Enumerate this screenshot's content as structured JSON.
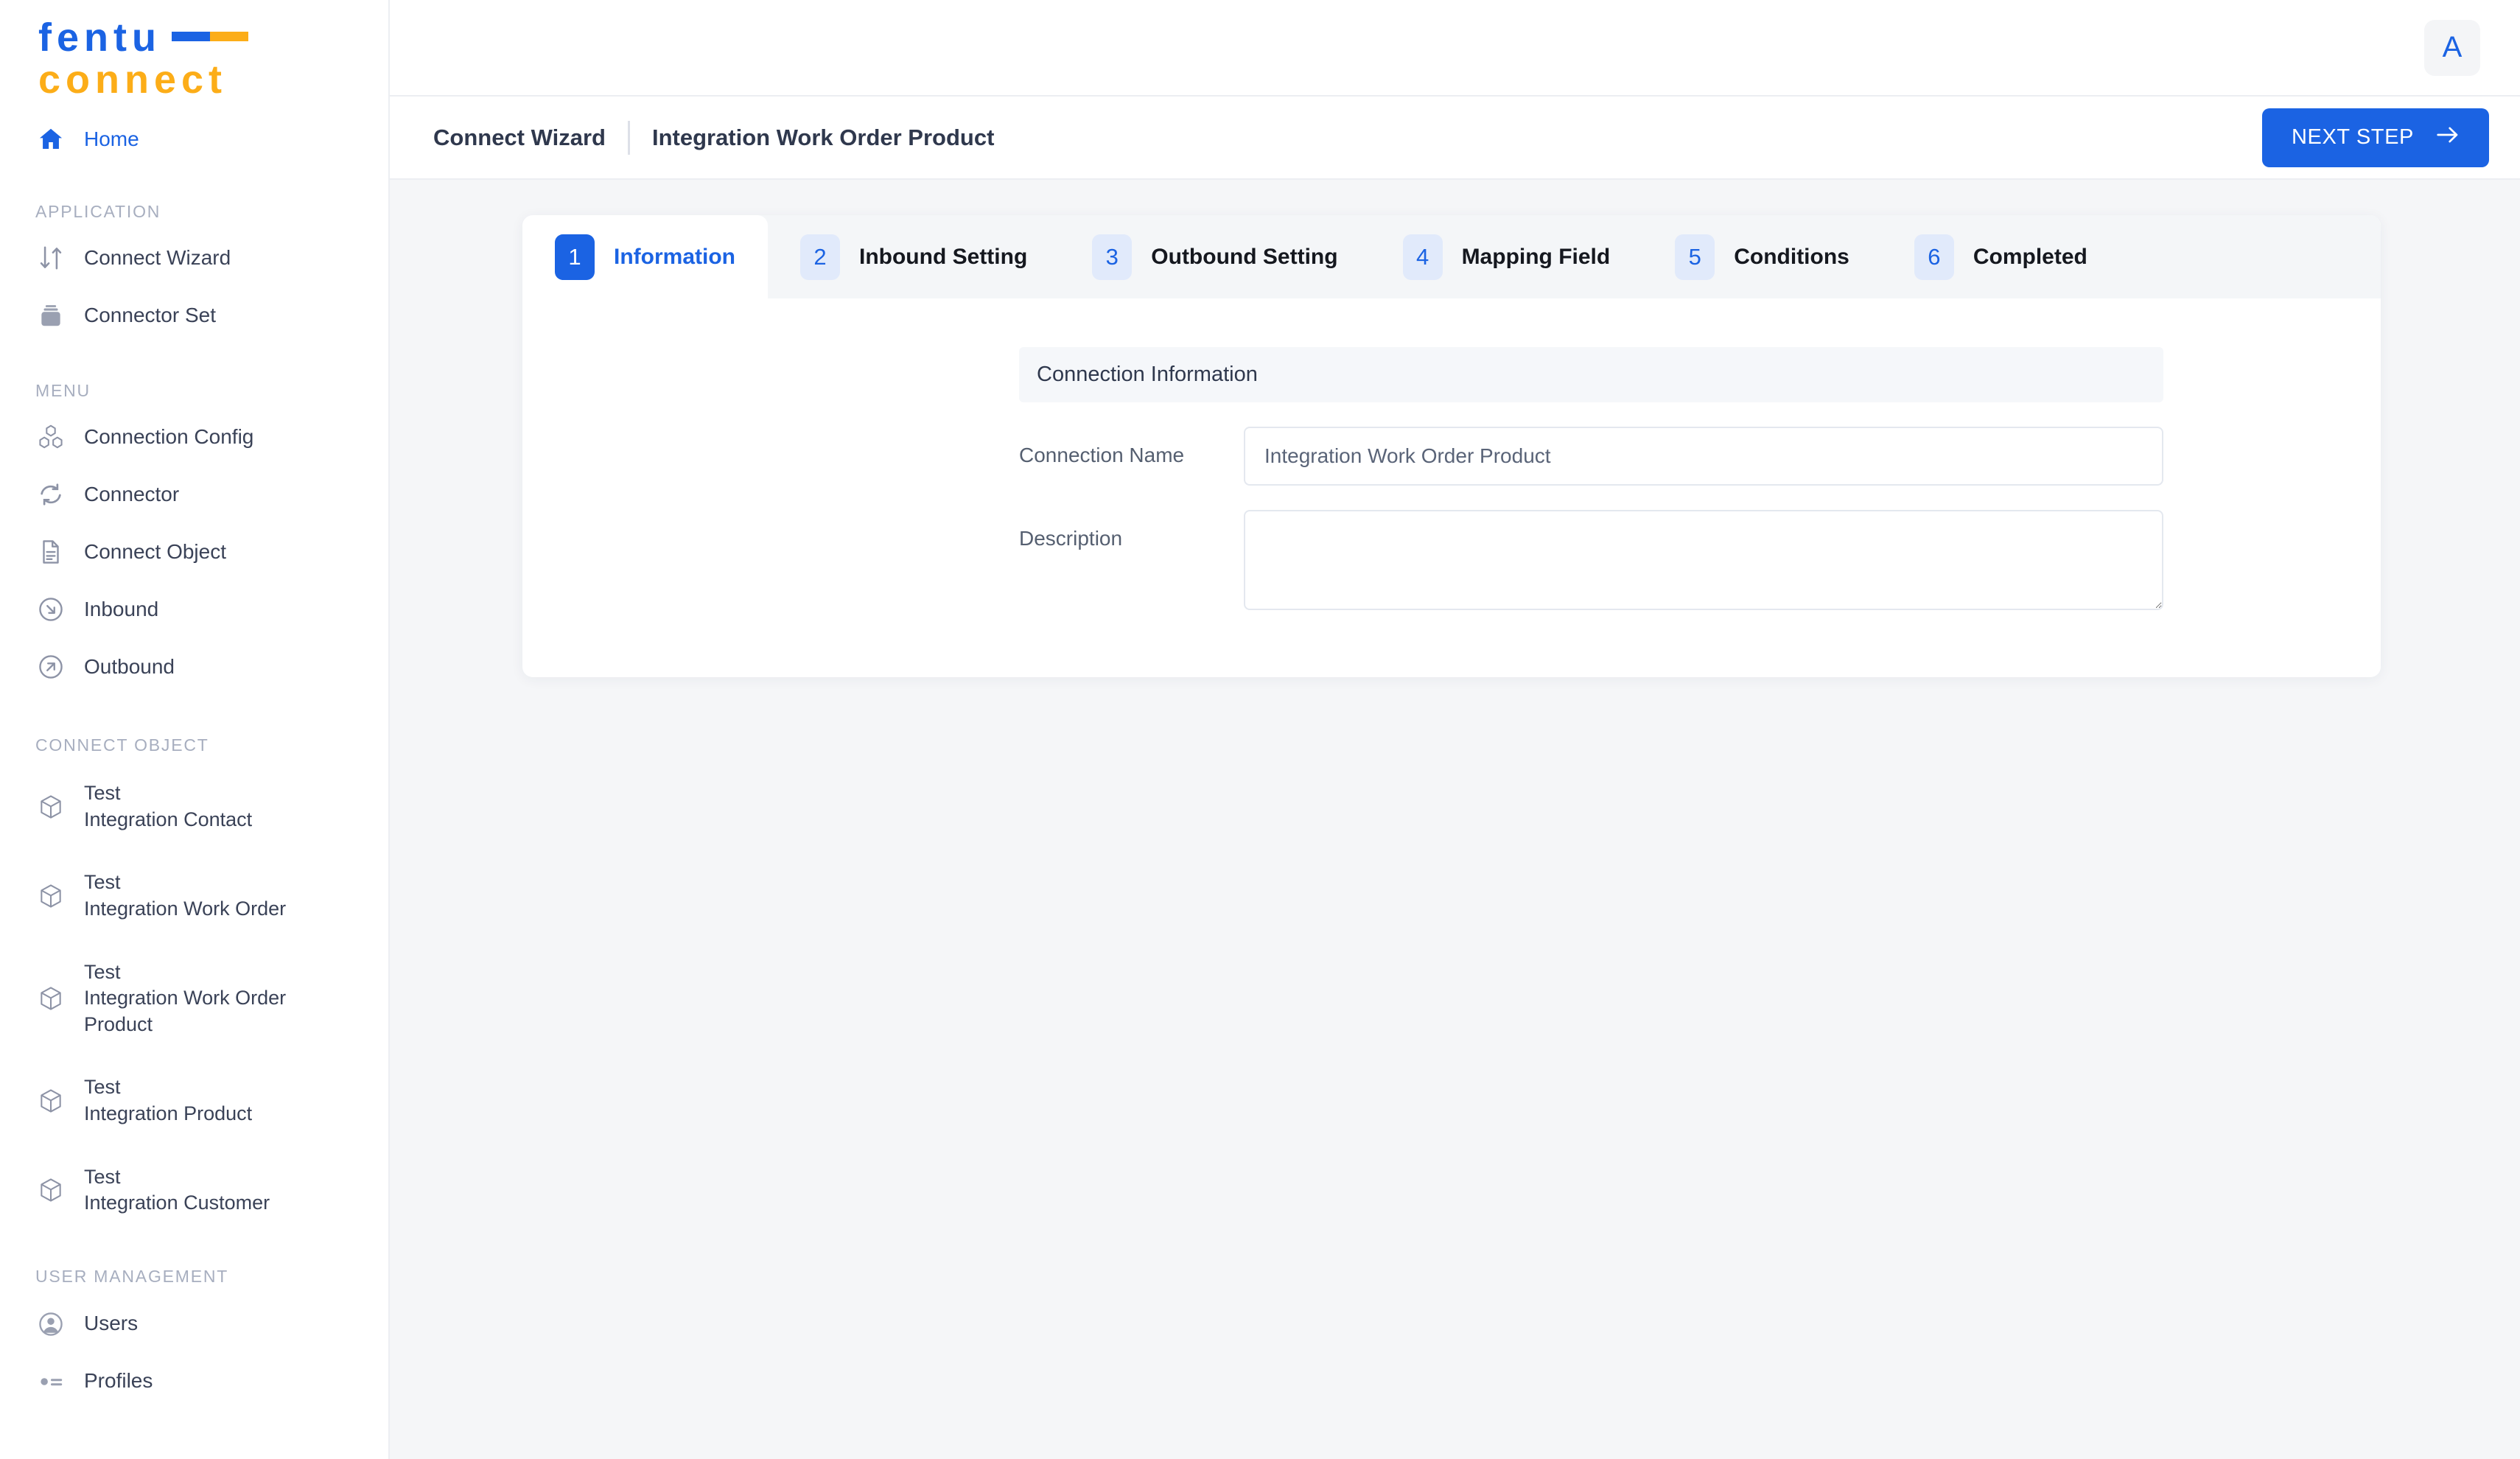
{
  "brand": {
    "word1": "fentu",
    "word2": "connect"
  },
  "sidebar": {
    "home": {
      "label": "Home"
    },
    "sections": [
      {
        "title": "APPLICATION",
        "items": [
          {
            "label": "Connect Wizard",
            "icon": "transfer-arrows-icon"
          },
          {
            "label": "Connector Set",
            "icon": "stack-icon"
          }
        ]
      },
      {
        "title": "MENU",
        "items": [
          {
            "label": "Connection Config",
            "icon": "blocks-icon"
          },
          {
            "label": "Connector",
            "icon": "sync-icon"
          },
          {
            "label": "Connect Object",
            "icon": "document-icon"
          },
          {
            "label": "Inbound",
            "icon": "arrow-down-right-circle-icon"
          },
          {
            "label": "Outbound",
            "icon": "arrow-up-right-circle-icon"
          }
        ]
      },
      {
        "title": "CONNECT OBJECT",
        "objects": [
          {
            "line1": "Test",
            "line2": "Integration Contact"
          },
          {
            "line1": "Test",
            "line2": "Integration Work Order"
          },
          {
            "line1": "Test",
            "line2": "Integration Work Order Product"
          },
          {
            "line1": "Test",
            "line2": "Integration Product"
          },
          {
            "line1": "Test",
            "line2": "Integration Customer"
          }
        ]
      },
      {
        "title": "USER MANAGEMENT",
        "items": [
          {
            "label": "Users",
            "icon": "user-circle-icon"
          },
          {
            "label": "Profiles",
            "icon": "profile-list-icon"
          }
        ]
      }
    ]
  },
  "topbar": {
    "avatar_initial": "A"
  },
  "breadcrumb": {
    "root": "Connect Wizard",
    "current": "Integration Work Order Product",
    "next_step_label": "NEXT STEP"
  },
  "wizard": {
    "steps": [
      {
        "number": "1",
        "label": "Information",
        "active": true
      },
      {
        "number": "2",
        "label": "Inbound Setting",
        "active": false
      },
      {
        "number": "3",
        "label": "Outbound Setting",
        "active": false
      },
      {
        "number": "4",
        "label": "Mapping Field",
        "active": false
      },
      {
        "number": "5",
        "label": "Conditions",
        "active": false
      },
      {
        "number": "6",
        "label": "Completed",
        "active": false
      }
    ]
  },
  "form": {
    "section_title": "Connection Information",
    "connection_name": {
      "label": "Connection Name",
      "value": "Integration Work Order Product",
      "placeholder": ""
    },
    "description": {
      "label": "Description",
      "value": "",
      "placeholder": ""
    }
  },
  "colors": {
    "accent_blue": "#1b63e3",
    "accent_orange": "#fcad18",
    "page_bg": "#f5f6f8",
    "badge_bg": "#e1eafb"
  }
}
